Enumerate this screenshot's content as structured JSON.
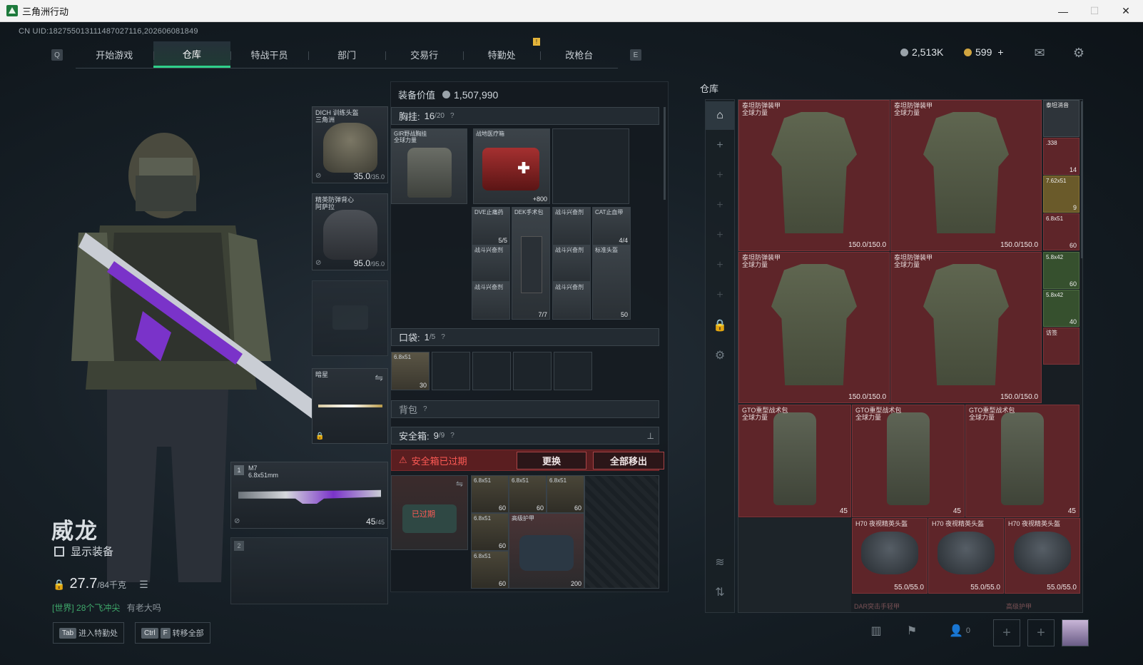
{
  "window": {
    "title": "三角洲行动",
    "minimize": "—",
    "maximize": "☐",
    "close": "✕"
  },
  "uid": "CN UID:18275501311148702711​6,202606081849",
  "nav": {
    "key_left": "Q",
    "key_right": "E",
    "tabs": [
      "开始游戏",
      "仓库",
      "特战干员",
      "部门",
      "交易行",
      "特勤处",
      "改枪台"
    ],
    "active": "仓库"
  },
  "currency": {
    "silver": "2,513K",
    "gold": "599",
    "plus": "+"
  },
  "operator": {
    "name": "威龙",
    "show_gear_label": "显示装备"
  },
  "weight": {
    "value": "27.7",
    "capacity": "/84千克"
  },
  "chat": {
    "channel": "[世界]",
    "user": "28个飞冲尖",
    "message": "有老大吗"
  },
  "bottom_buttons": [
    {
      "key": "Tab",
      "label": "进入特勤处"
    },
    {
      "key": "Ctrl",
      "key2": "F",
      "label": "转移全部"
    }
  ],
  "gear": {
    "helmet": {
      "name": "DICH 训练头盔",
      "sub": "三角洲",
      "durability": "35.0",
      "max": "/35.0"
    },
    "armor": {
      "name": "精英防弹背心",
      "sub": "阿萨拉",
      "durability": "95.0",
      "max": "/95.0"
    },
    "melee": {
      "name": "暗星"
    },
    "primary": {
      "slot": "1",
      "name": "M7",
      "ammo": "6.8x51mm",
      "count": "45",
      "max": "/45"
    },
    "secondary": {
      "slot": "2"
    }
  },
  "loadout": {
    "value_label": "装备价值",
    "value": "1,507,990",
    "rig": {
      "label": "胸挂:",
      "count": "16",
      "max": "/20",
      "q": "?"
    },
    "rig_item": {
      "name": "GIR野战胸挂",
      "sub": "全球力量"
    },
    "medkit": {
      "name": "战地医疗箱",
      "count": "+800"
    },
    "rig_cells": [
      {
        "name": "DVE止痛药",
        "count": "5/5"
      },
      {
        "name": "DEK手术包",
        "count": "7/7"
      },
      {
        "name": "战斗兴奋剂",
        "count": ""
      },
      {
        "name": "CAT止血带",
        "count": "4/4"
      },
      {
        "name": "战斗兴奋剂",
        "count": ""
      },
      {
        "name": "战斗兴奋剂",
        "count": ""
      },
      {
        "name": "标准头盔",
        "count": "50"
      },
      {
        "name": "战斗兴奋剂",
        "count": ""
      },
      {
        "name": "战斗兴奋剂",
        "count": ""
      }
    ],
    "pocket": {
      "label": "口袋:",
      "count": "1",
      "max": "/5",
      "q": "?"
    },
    "pocket_item": {
      "name": "6.8x51",
      "count": "30"
    },
    "backpack": {
      "label": "背包",
      "q": "?"
    },
    "safebox": {
      "label": "安全箱:",
      "count": "9",
      "max": "/9",
      "q": "?"
    },
    "expired_msg": "安全箱已过期",
    "replace_btn": "更换",
    "remove_all_btn": "全部移出",
    "expired_overlay": "已过期",
    "safebox_items": [
      {
        "name": "6.8x51",
        "count": "60"
      },
      {
        "name": "6.8x51",
        "count": "60"
      },
      {
        "name": "6.8x51",
        "count": "60"
      },
      {
        "name": "6.8x51",
        "count": "60"
      },
      {
        "name": "6.8x51",
        "count": "60"
      }
    ],
    "safebox_bag": {
      "name": "高级护甲",
      "count": "200"
    }
  },
  "warehouse": {
    "title": "仓库",
    "vests": [
      {
        "name": "泰坦防弹装甲",
        "sub": "全球力量",
        "durability": "150.0/150.0"
      },
      {
        "name": "泰坦防弹装甲",
        "sub": "全球力量",
        "durability": "150.0/150.0"
      },
      {
        "name": "泰坦防弹装甲",
        "sub": "全球力量",
        "durability": "150.0/150.0"
      },
      {
        "name": "泰坦防弹装甲",
        "sub": "全球力量",
        "durability": "150.0/150.0"
      }
    ],
    "bags": [
      {
        "name": "GTO重型战术包",
        "sub": "全球力量",
        "count": "45"
      },
      {
        "name": "GTO重型战术包",
        "sub": "全球力量",
        "count": "45"
      },
      {
        "name": "GTO重型战术包",
        "sub": "全球力量",
        "count": "45"
      }
    ],
    "nvgs": [
      {
        "name": "H70 夜视精英头盔",
        "durability": "55.0/55.0"
      },
      {
        "name": "H70 夜视精英头盔",
        "durability": "55.0/55.0"
      },
      {
        "name": "H70 夜视精英头盔",
        "durability": "55.0/55.0"
      }
    ],
    "small": [
      {
        "name": "泰坦消音",
        "count": ""
      },
      {
        "name": ".338",
        "count": "14"
      },
      {
        "name": "7.62x51",
        "count": "9"
      },
      {
        "name": "6.8x51",
        "count": "60"
      },
      {
        "name": "5.8x42",
        "count": "60"
      },
      {
        "name": "5.8x42",
        "count": "40"
      },
      {
        "name": "访签",
        "count": ""
      }
    ],
    "footer_a": "DAR突击手轻甲",
    "footer_b": "高级护甲"
  },
  "bottom_bar": {
    "friends_count": "0"
  },
  "colors": {
    "accent": "#2fd08a",
    "danger": "#ff5a55",
    "item_red": "#5e2529"
  }
}
